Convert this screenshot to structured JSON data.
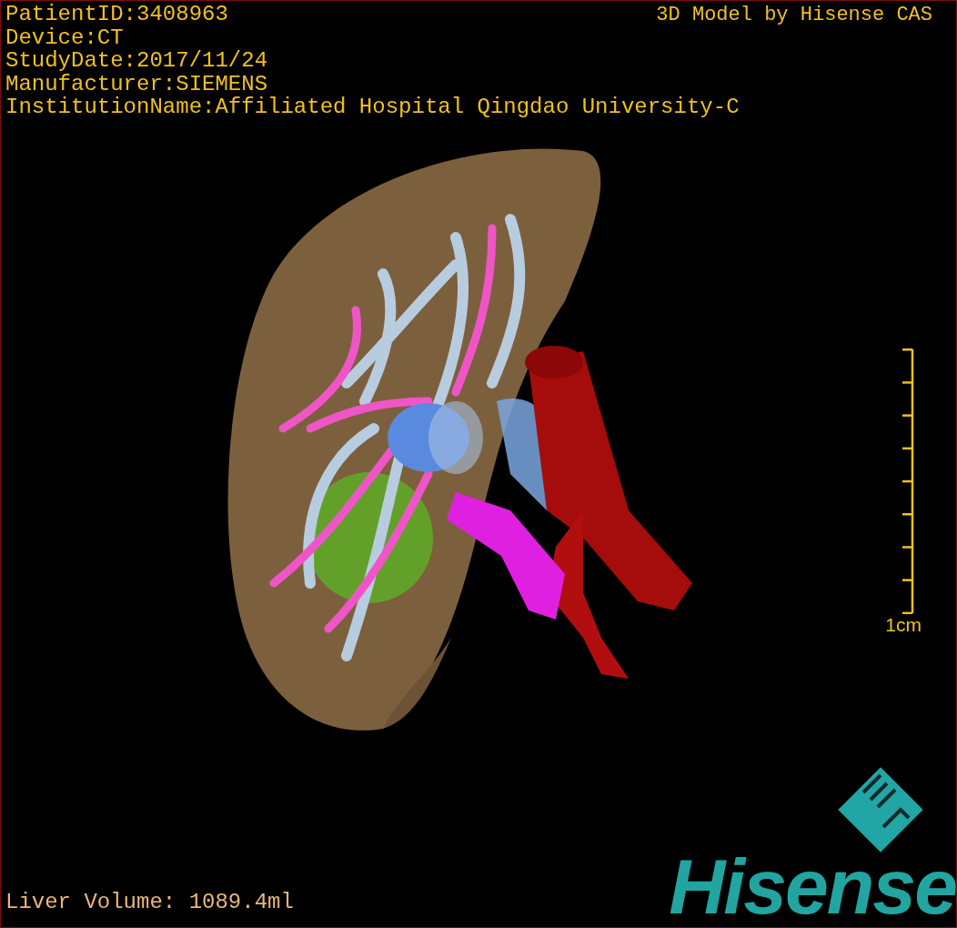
{
  "patient_info": [
    "PatientID:3408963",
    "Device:CT",
    "StudyDate:2017/11/24",
    "Manufacturer:SIEMENS",
    "InstitutionName:Affiliated Hospital Qingdao University-C"
  ],
  "model_credit": "3D Model by Hisense CAS",
  "scale_bar": {
    "label": "1cm"
  },
  "measurement": "Liver Volume: 1089.4ml",
  "logo": {
    "wordmark": "Hisense"
  }
}
